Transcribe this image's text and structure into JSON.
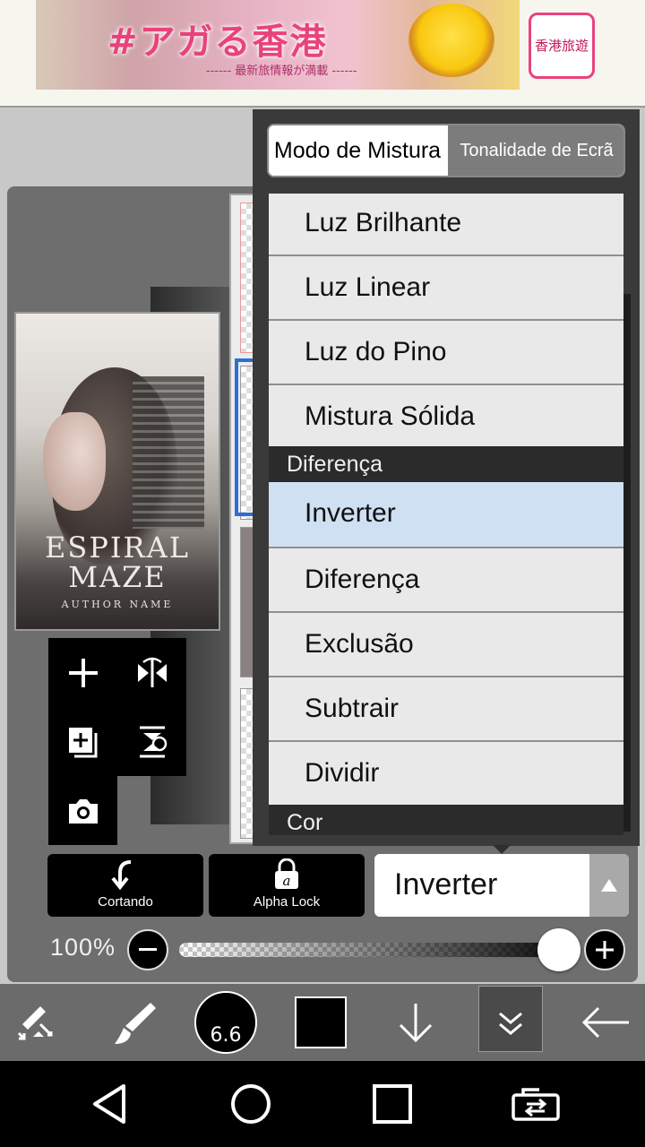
{
  "ad": {
    "title": "#アガる香港",
    "subtitle": "------ 最新旅情報が満載 ------",
    "logo_text": "香港旅遊"
  },
  "preview": {
    "title_line1": "ESPIRAL",
    "title_line2": "MAZE",
    "author": "AUTHOR NAME"
  },
  "tabs": {
    "blend_mode": "Modo de Mistura",
    "screen_tone": "Tonalidade de Ecrã"
  },
  "menu": {
    "items_top": [
      "Luz Brilhante",
      "Luz Linear",
      "Luz do Pino",
      "Mistura Sólida"
    ],
    "header_difference": "Diferença",
    "items_difference": [
      "Inverter",
      "Diferença",
      "Exclusão",
      "Subtrair",
      "Dividir"
    ],
    "header_color": "Cor",
    "selected": "Inverter"
  },
  "controls": {
    "clipping_label": "Cortando",
    "alpha_lock_label": "Alpha Lock",
    "blend_value": "Inverter",
    "opacity_label": "100%",
    "opacity_value": 100
  },
  "toolbar": {
    "brush_size": "6.6",
    "color": "#000000"
  },
  "icons": {
    "add_layer": "plus-icon",
    "flip": "flip-horizontal-icon",
    "duplicate": "add-copy-icon",
    "merge": "merge-down-icon",
    "camera": "camera-icon",
    "clipping": "clip-arrow-icon",
    "alpha_lock": "alpha-lock-icon"
  },
  "colors": {
    "selected_item": "#cfe0f2",
    "selection_border": "#2c6fd1",
    "header_bg": "#2b2b2b"
  }
}
